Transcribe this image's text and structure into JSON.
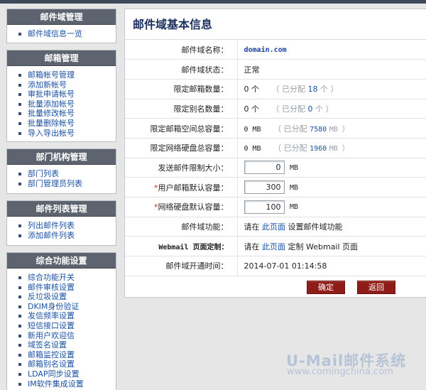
{
  "sidebar": {
    "panels": [
      {
        "title": "邮件域管理",
        "items": [
          "邮件域信息一览"
        ]
      },
      {
        "title": "邮箱管理",
        "items": [
          "邮箱帐号管理",
          "添加新帐号",
          "审批申请帐号",
          "批量添加帐号",
          "批量修改帐号",
          "批量删除帐号",
          "导入导出帐号"
        ]
      },
      {
        "title": "部门机构管理",
        "items": [
          "部门列表",
          "部门管理员列表"
        ]
      },
      {
        "title": "邮件列表管理",
        "items": [
          "列出邮件列表",
          "添加邮件列表"
        ]
      },
      {
        "title": "综合功能设置",
        "items": [
          "综合功能开关",
          "邮件审核设置",
          "反垃圾设置",
          "DKIM身份验证",
          "发信频率设置",
          "短信接口设置",
          "新用户欢迎信",
          "域签名设置",
          "邮箱监控设置",
          "邮箱别名设置",
          "LDAP同步设置",
          "IM软件集成设置"
        ]
      }
    ]
  },
  "main": {
    "title": "邮件域基本信息",
    "rows": {
      "domain_name": {
        "label": "邮件域名称：",
        "value": "domain.com"
      },
      "domain_status": {
        "label": "邮件域状态：",
        "value": "正常"
      },
      "mailbox_limit": {
        "label": "限定邮箱数量：",
        "value": "0 个",
        "alloc_prefix": "（ 已分配",
        "alloc_value": "18",
        "alloc_suffix": "个 ）"
      },
      "alias_limit": {
        "label": "限定别名数量：",
        "value": "0 个",
        "alloc_prefix": "（ 已分配",
        "alloc_value": "0",
        "alloc_suffix": "个 ）"
      },
      "mail_space": {
        "label": "限定邮箱空间总容量：",
        "value": "0 MB",
        "alloc_prefix": "（ 已分配",
        "alloc_value": "7580",
        "alloc_suffix": "MB ）"
      },
      "disk_space": {
        "label": "限定网络硬盘总容量：",
        "value": "0 MB",
        "alloc_prefix": "（ 已分配",
        "alloc_value": "1960",
        "alloc_suffix": "MB ）"
      },
      "send_limit": {
        "label": "发送邮件限制大小：",
        "value": "0",
        "unit": "MB"
      },
      "mailbox_default": {
        "label": "用户邮箱默认容量：",
        "value": "300",
        "unit": "MB"
      },
      "disk_default": {
        "label": "网络硬盘默认容量：",
        "value": "100",
        "unit": "MB"
      },
      "domain_function": {
        "label": "邮件域功能：",
        "prefix": "请在",
        "link": "此页面",
        "suffix": "设置邮件域功能"
      },
      "webmail_custom": {
        "label": "Webmail 页面定制：",
        "prefix": "请在",
        "link": "此页面",
        "suffix": "定制 Webmail 页面"
      },
      "open_time": {
        "label": "邮件域开通时间：",
        "value": "2014-07-01 01:14:58"
      }
    },
    "buttons": {
      "ok": "确定",
      "back": "返回"
    }
  },
  "watermark": {
    "brand": "U-Mail邮件系统",
    "url": "www.comingchina.com"
  }
}
